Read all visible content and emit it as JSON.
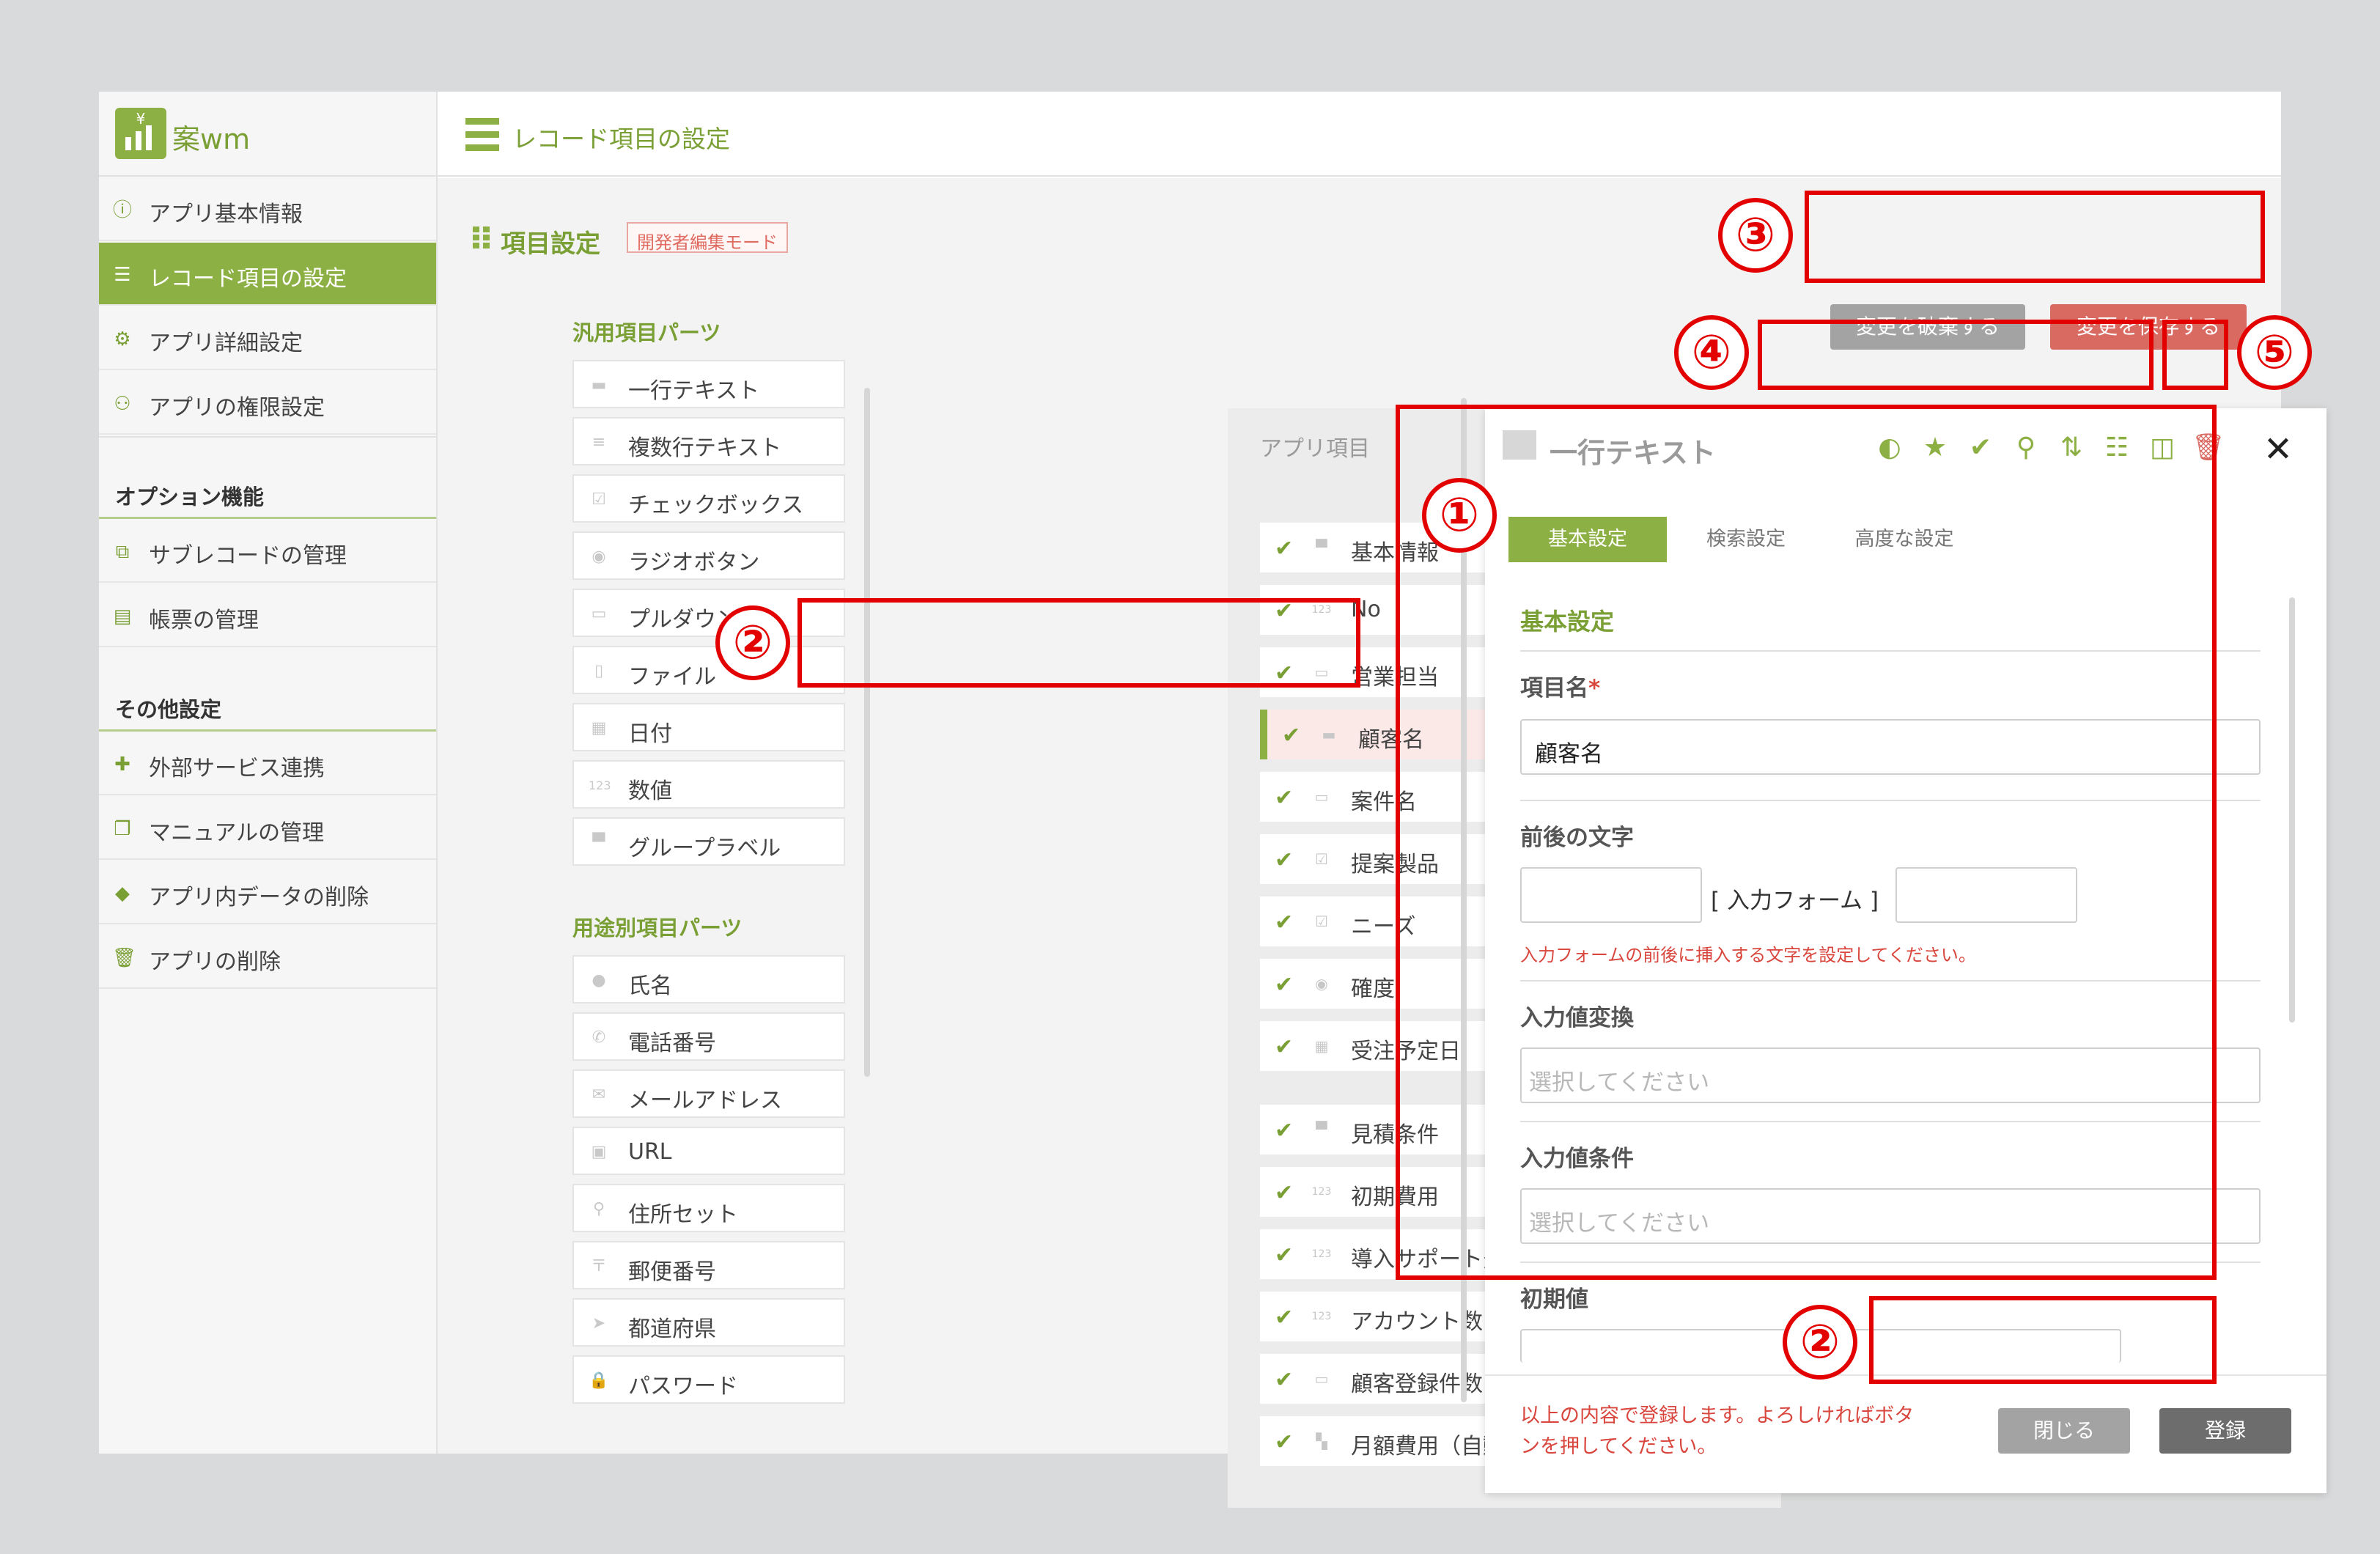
{
  "logo": {
    "text": "案wm"
  },
  "sidebar": {
    "items": [
      {
        "label": "アプリ基本情報",
        "icon": "info-icon"
      },
      {
        "label": "レコード項目の設定",
        "icon": "list-icon"
      },
      {
        "label": "アプリ詳細設定",
        "icon": "gear-icon"
      },
      {
        "label": "アプリの権限設定",
        "icon": "users-lock-icon"
      }
    ],
    "section_options": "オプション機能",
    "options": [
      {
        "label": "サブレコードの管理",
        "icon": "layers-icon"
      },
      {
        "label": "帳票の管理",
        "icon": "excel-icon"
      }
    ],
    "section_others": "その他設定",
    "others": [
      {
        "label": "外部サービス連携",
        "icon": "puzzle-icon"
      },
      {
        "label": "マニュアルの管理",
        "icon": "book-icon"
      },
      {
        "label": "アプリ内データの削除",
        "icon": "eraser-icon"
      },
      {
        "label": "アプリの削除",
        "icon": "trash-icon"
      }
    ]
  },
  "header": {
    "title": "レコード項目の設定"
  },
  "section": {
    "title": "項目設定",
    "badge": "開発者編集モード"
  },
  "actions": {
    "discard": "変更を破棄する",
    "save": "変更を保存する"
  },
  "parts": {
    "general_title": "汎用項目パーツ",
    "general": [
      "一行テキスト",
      "複数行テキスト",
      "チェックボックス",
      "ラジオボタン",
      "プルダウン",
      "ファイル",
      "日付",
      "数値",
      "グループラベル"
    ],
    "purpose_title": "用途別項目パーツ",
    "purpose": [
      "氏名",
      "電話番号",
      "メールアドレス",
      "URL",
      "住所セット",
      "郵便番号",
      "都道府県",
      "パスワード"
    ]
  },
  "items": {
    "title": "アプリ項目",
    "list": [
      "基本情報",
      "No",
      "営業担当",
      "顧客名",
      "案件名",
      "提案製品",
      "ニーズ",
      "確度",
      "受注予定日",
      "見積条件",
      "初期費用",
      "導入サポート費用",
      "アカウント数",
      "顧客登録件数",
      "月額費用（自動計算）"
    ]
  },
  "panel": {
    "title": "一行テキスト",
    "tabs": [
      "基本設定",
      "検索設定",
      "高度な設定"
    ],
    "section_title": "基本設定",
    "field_name_label": "項目名",
    "field_name_required": "*",
    "field_name_value": "顧客名",
    "affix_label": "前後の文字",
    "affix_middle": "[ 入力フォーム ]",
    "affix_note": "入力フォームの前後に挿入する文字を設定してください。",
    "convert_label": "入力値変換",
    "convert_placeholder": "選択してください",
    "condition_label": "入力値条件",
    "condition_placeholder": "選択してください",
    "default_label": "初期値",
    "footer_note_1": "以上の内容で登録します。よろしければボタ",
    "footer_note_2": "ンを押してください。",
    "close": "閉じる",
    "register": "登録"
  },
  "annotations": [
    "①",
    "②",
    "③",
    "④",
    "⑤",
    "②"
  ],
  "colors": {
    "accent": "#8cb044",
    "danger": "#d96a62",
    "annotation": "#e30000"
  }
}
